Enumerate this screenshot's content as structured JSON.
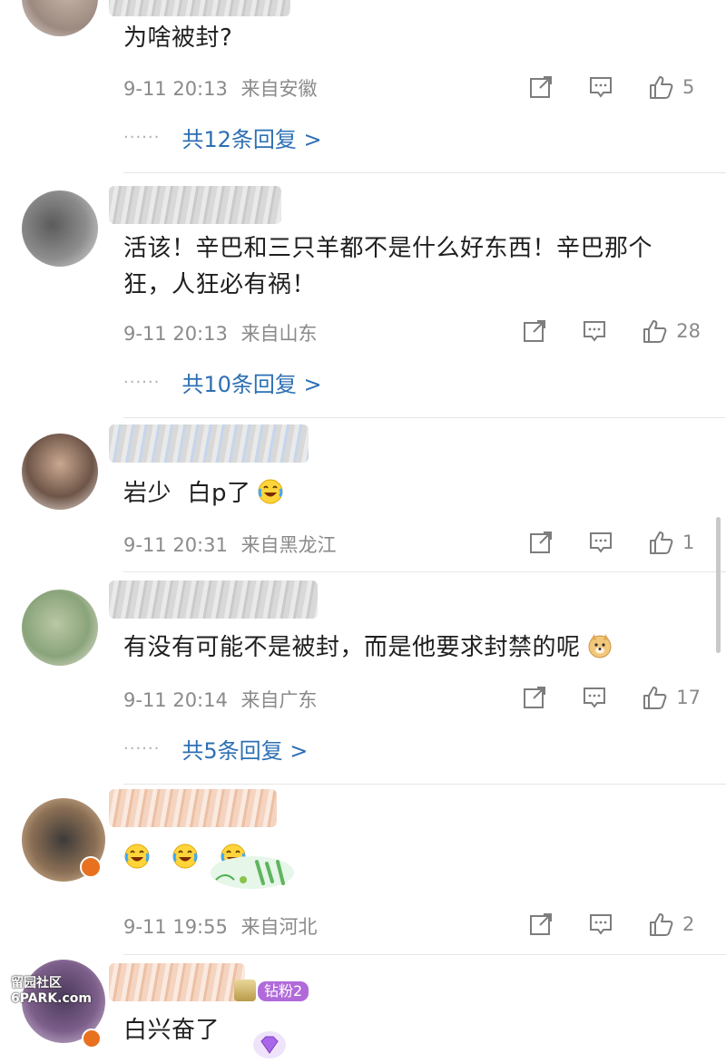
{
  "comments": [
    {
      "text": "为啥被封?",
      "time": "9-11 20:13",
      "location": "来自安徽",
      "likes": "5",
      "replies": "共12条回复 >"
    },
    {
      "text": "活该！辛巴和三只羊都不是什么好东西！辛巴那个狂，人狂必有祸！",
      "time": "9-11 20:13",
      "location": "来自山东",
      "likes": "28",
      "replies": "共10条回复 >"
    },
    {
      "text": "岩少  白p了",
      "time": "9-11 20:31",
      "location": "来自黑龙江",
      "likes": "1",
      "replies": ""
    },
    {
      "text": "有没有可能不是被封，而是他要求封禁的呢",
      "time": "9-11 20:14",
      "location": "来自广东",
      "likes": "17",
      "replies": "共5条回复 >"
    },
    {
      "text": "",
      "time": "9-11 19:55",
      "location": "来自河北",
      "likes": "2",
      "replies": ""
    },
    {
      "text": "白兴奋了",
      "badge": "钻粉2",
      "time": "",
      "location": "",
      "likes": "",
      "replies": ""
    }
  ],
  "icons": {
    "share": "share-icon",
    "comment": "comment-icon",
    "like": "thumbs-up-icon",
    "laugh": "laugh-cry-emoji",
    "doge": "doge-emoji"
  },
  "replies_dots": "······",
  "watermark": {
    "line1": "留园社区",
    "line2": "6PARK.com"
  },
  "colors": {
    "link": "#2d6fb3",
    "meta": "#8a8a8a",
    "badge": "#b06ad9"
  }
}
